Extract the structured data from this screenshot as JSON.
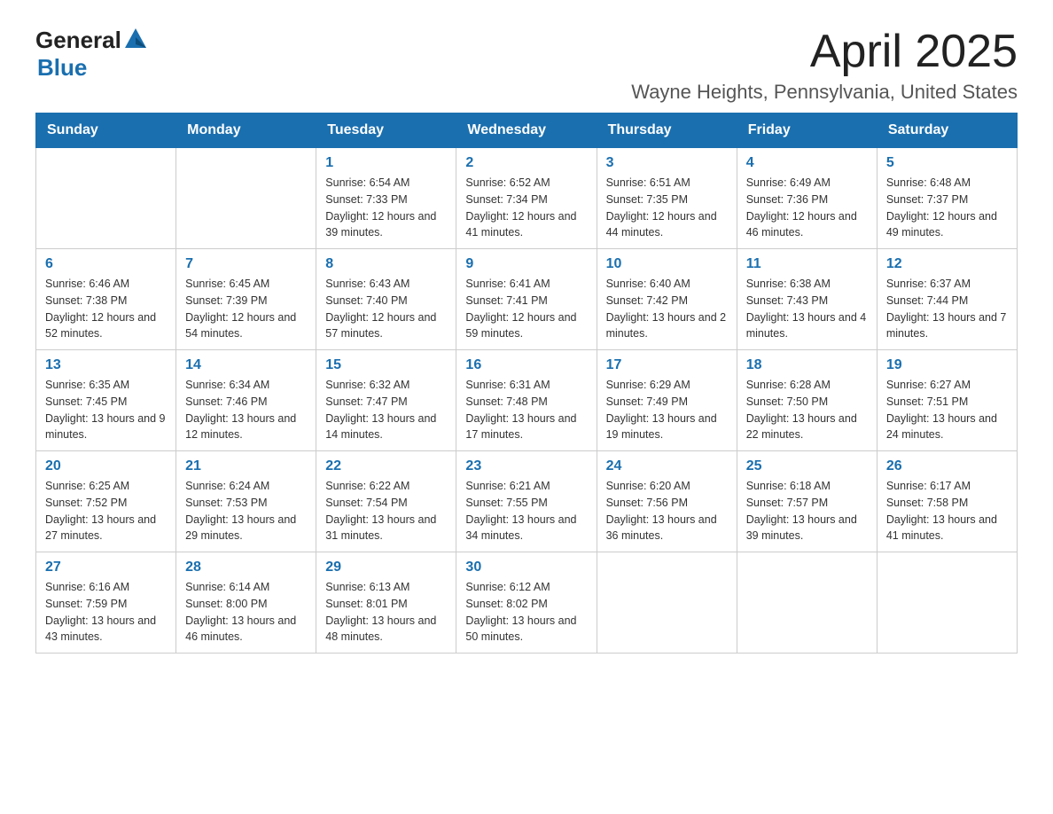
{
  "logo": {
    "text_general": "General",
    "text_blue": "Blue",
    "arrow_color": "#1a6faf"
  },
  "title": "April 2025",
  "subtitle": "Wayne Heights, Pennsylvania, United States",
  "days_of_week": [
    "Sunday",
    "Monday",
    "Tuesday",
    "Wednesday",
    "Thursday",
    "Friday",
    "Saturday"
  ],
  "weeks": [
    [
      {
        "day": "",
        "sunrise": "",
        "sunset": "",
        "daylight": ""
      },
      {
        "day": "",
        "sunrise": "",
        "sunset": "",
        "daylight": ""
      },
      {
        "day": "1",
        "sunrise": "Sunrise: 6:54 AM",
        "sunset": "Sunset: 7:33 PM",
        "daylight": "Daylight: 12 hours and 39 minutes."
      },
      {
        "day": "2",
        "sunrise": "Sunrise: 6:52 AM",
        "sunset": "Sunset: 7:34 PM",
        "daylight": "Daylight: 12 hours and 41 minutes."
      },
      {
        "day": "3",
        "sunrise": "Sunrise: 6:51 AM",
        "sunset": "Sunset: 7:35 PM",
        "daylight": "Daylight: 12 hours and 44 minutes."
      },
      {
        "day": "4",
        "sunrise": "Sunrise: 6:49 AM",
        "sunset": "Sunset: 7:36 PM",
        "daylight": "Daylight: 12 hours and 46 minutes."
      },
      {
        "day": "5",
        "sunrise": "Sunrise: 6:48 AM",
        "sunset": "Sunset: 7:37 PM",
        "daylight": "Daylight: 12 hours and 49 minutes."
      }
    ],
    [
      {
        "day": "6",
        "sunrise": "Sunrise: 6:46 AM",
        "sunset": "Sunset: 7:38 PM",
        "daylight": "Daylight: 12 hours and 52 minutes."
      },
      {
        "day": "7",
        "sunrise": "Sunrise: 6:45 AM",
        "sunset": "Sunset: 7:39 PM",
        "daylight": "Daylight: 12 hours and 54 minutes."
      },
      {
        "day": "8",
        "sunrise": "Sunrise: 6:43 AM",
        "sunset": "Sunset: 7:40 PM",
        "daylight": "Daylight: 12 hours and 57 minutes."
      },
      {
        "day": "9",
        "sunrise": "Sunrise: 6:41 AM",
        "sunset": "Sunset: 7:41 PM",
        "daylight": "Daylight: 12 hours and 59 minutes."
      },
      {
        "day": "10",
        "sunrise": "Sunrise: 6:40 AM",
        "sunset": "Sunset: 7:42 PM",
        "daylight": "Daylight: 13 hours and 2 minutes."
      },
      {
        "day": "11",
        "sunrise": "Sunrise: 6:38 AM",
        "sunset": "Sunset: 7:43 PM",
        "daylight": "Daylight: 13 hours and 4 minutes."
      },
      {
        "day": "12",
        "sunrise": "Sunrise: 6:37 AM",
        "sunset": "Sunset: 7:44 PM",
        "daylight": "Daylight: 13 hours and 7 minutes."
      }
    ],
    [
      {
        "day": "13",
        "sunrise": "Sunrise: 6:35 AM",
        "sunset": "Sunset: 7:45 PM",
        "daylight": "Daylight: 13 hours and 9 minutes."
      },
      {
        "day": "14",
        "sunrise": "Sunrise: 6:34 AM",
        "sunset": "Sunset: 7:46 PM",
        "daylight": "Daylight: 13 hours and 12 minutes."
      },
      {
        "day": "15",
        "sunrise": "Sunrise: 6:32 AM",
        "sunset": "Sunset: 7:47 PM",
        "daylight": "Daylight: 13 hours and 14 minutes."
      },
      {
        "day": "16",
        "sunrise": "Sunrise: 6:31 AM",
        "sunset": "Sunset: 7:48 PM",
        "daylight": "Daylight: 13 hours and 17 minutes."
      },
      {
        "day": "17",
        "sunrise": "Sunrise: 6:29 AM",
        "sunset": "Sunset: 7:49 PM",
        "daylight": "Daylight: 13 hours and 19 minutes."
      },
      {
        "day": "18",
        "sunrise": "Sunrise: 6:28 AM",
        "sunset": "Sunset: 7:50 PM",
        "daylight": "Daylight: 13 hours and 22 minutes."
      },
      {
        "day": "19",
        "sunrise": "Sunrise: 6:27 AM",
        "sunset": "Sunset: 7:51 PM",
        "daylight": "Daylight: 13 hours and 24 minutes."
      }
    ],
    [
      {
        "day": "20",
        "sunrise": "Sunrise: 6:25 AM",
        "sunset": "Sunset: 7:52 PM",
        "daylight": "Daylight: 13 hours and 27 minutes."
      },
      {
        "day": "21",
        "sunrise": "Sunrise: 6:24 AM",
        "sunset": "Sunset: 7:53 PM",
        "daylight": "Daylight: 13 hours and 29 minutes."
      },
      {
        "day": "22",
        "sunrise": "Sunrise: 6:22 AM",
        "sunset": "Sunset: 7:54 PM",
        "daylight": "Daylight: 13 hours and 31 minutes."
      },
      {
        "day": "23",
        "sunrise": "Sunrise: 6:21 AM",
        "sunset": "Sunset: 7:55 PM",
        "daylight": "Daylight: 13 hours and 34 minutes."
      },
      {
        "day": "24",
        "sunrise": "Sunrise: 6:20 AM",
        "sunset": "Sunset: 7:56 PM",
        "daylight": "Daylight: 13 hours and 36 minutes."
      },
      {
        "day": "25",
        "sunrise": "Sunrise: 6:18 AM",
        "sunset": "Sunset: 7:57 PM",
        "daylight": "Daylight: 13 hours and 39 minutes."
      },
      {
        "day": "26",
        "sunrise": "Sunrise: 6:17 AM",
        "sunset": "Sunset: 7:58 PM",
        "daylight": "Daylight: 13 hours and 41 minutes."
      }
    ],
    [
      {
        "day": "27",
        "sunrise": "Sunrise: 6:16 AM",
        "sunset": "Sunset: 7:59 PM",
        "daylight": "Daylight: 13 hours and 43 minutes."
      },
      {
        "day": "28",
        "sunrise": "Sunrise: 6:14 AM",
        "sunset": "Sunset: 8:00 PM",
        "daylight": "Daylight: 13 hours and 46 minutes."
      },
      {
        "day": "29",
        "sunrise": "Sunrise: 6:13 AM",
        "sunset": "Sunset: 8:01 PM",
        "daylight": "Daylight: 13 hours and 48 minutes."
      },
      {
        "day": "30",
        "sunrise": "Sunrise: 6:12 AM",
        "sunset": "Sunset: 8:02 PM",
        "daylight": "Daylight: 13 hours and 50 minutes."
      },
      {
        "day": "",
        "sunrise": "",
        "sunset": "",
        "daylight": ""
      },
      {
        "day": "",
        "sunrise": "",
        "sunset": "",
        "daylight": ""
      },
      {
        "day": "",
        "sunrise": "",
        "sunset": "",
        "daylight": ""
      }
    ]
  ]
}
